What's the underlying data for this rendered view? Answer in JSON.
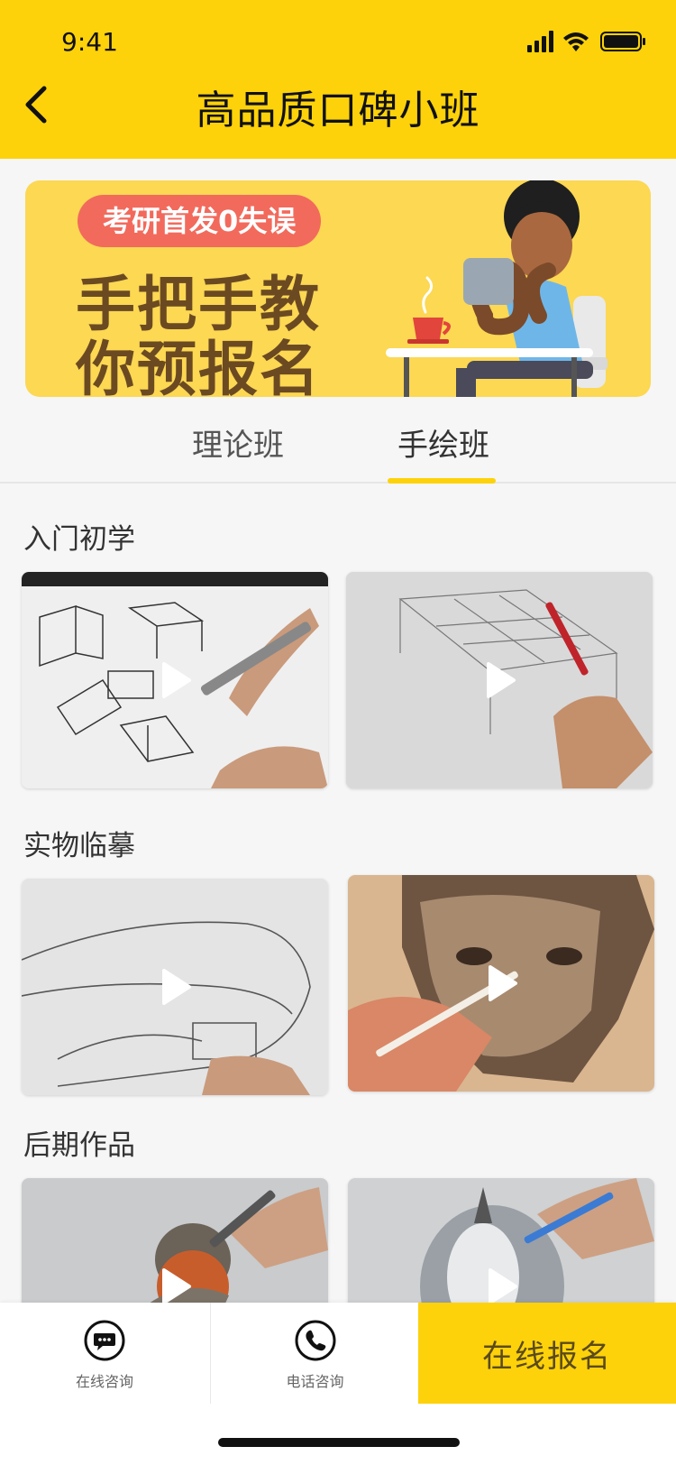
{
  "status_bar": {
    "time": "9:41"
  },
  "header": {
    "title": "高品质口碑小班"
  },
  "banner": {
    "badge": "考研首发0失误",
    "line1": "手把手教",
    "line2": "你预报名"
  },
  "tabs": [
    {
      "label": "理论班",
      "active": false
    },
    {
      "label": "手绘班",
      "active": true
    }
  ],
  "sections": [
    {
      "title": "入门初学"
    },
    {
      "title": "实物临摹"
    },
    {
      "title": "后期作品"
    }
  ],
  "bottom_bar": {
    "chat_label": "在线咨询",
    "phone_label": "电话咨询",
    "signup_label": "在线报名"
  },
  "colors": {
    "accent": "#FDD20A",
    "badge": "#F26A5C",
    "banner_bg": "#FCD853",
    "banner_text": "#6B4A22"
  }
}
